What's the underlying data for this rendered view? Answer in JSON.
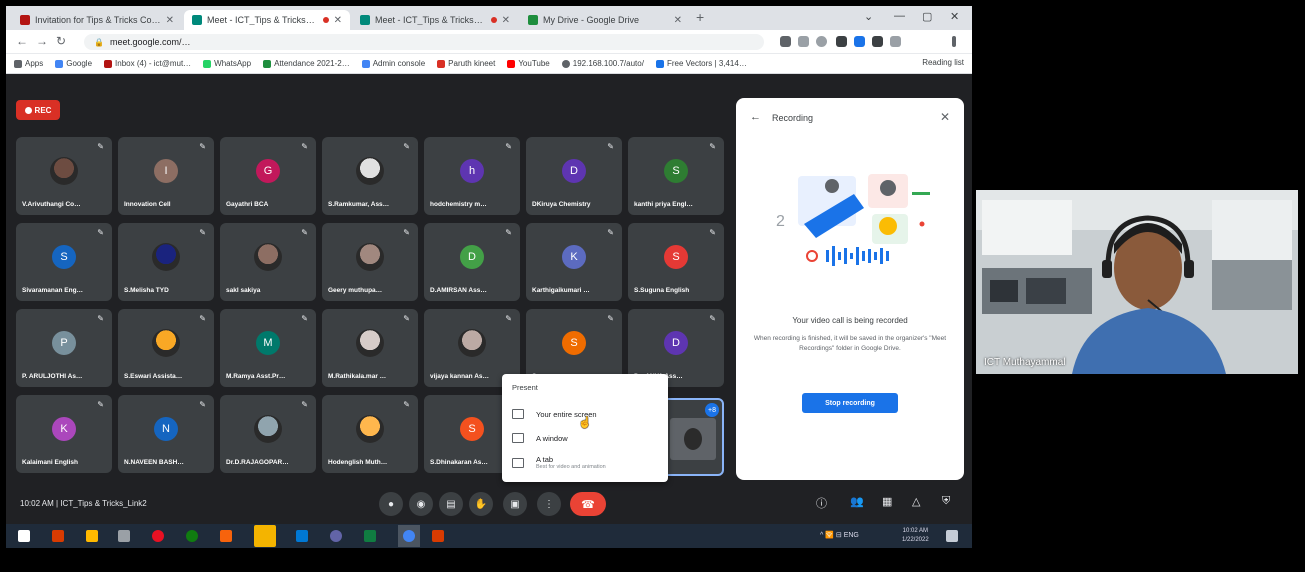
{
  "browser": {
    "tabs": [
      {
        "label": "Invitation for Tips & Tricks Co…",
        "favicon_color": "#b31412",
        "active": false,
        "recording": false
      },
      {
        "label": "Meet - ICT_Tips & Tricks_Li…",
        "favicon_color": "#00897b",
        "active": true,
        "recording": true
      },
      {
        "label": "Meet - ICT_Tips & Tricks_Li…",
        "favicon_color": "#00897b",
        "active": false,
        "recording": true
      },
      {
        "label": "My Drive - Google Drive",
        "favicon_color": "#1e8e3e",
        "active": false,
        "recording": false
      }
    ],
    "new_tab": "+",
    "url": "meet.google.com/…",
    "bookmarks": [
      {
        "label": "Apps",
        "color": "#5f6368"
      },
      {
        "label": "Google",
        "color": "#4285f4"
      },
      {
        "label": "Inbox (4) - ict@mut…",
        "color": "#b31412"
      },
      {
        "label": "WhatsApp",
        "color": "#25d366"
      },
      {
        "label": "Attendance 2021-2…",
        "color": "#1e8e3e"
      },
      {
        "label": "Admin console",
        "color": "#4285f4"
      },
      {
        "label": "Paruth kineet",
        "color": "#d93025"
      },
      {
        "label": "YouTube",
        "color": "#ff0000"
      },
      {
        "label": "192.168.100.7/auto/",
        "color": "#5f6368"
      },
      {
        "label": "Free Vectors | 3,414…",
        "color": "#1a73e8"
      }
    ],
    "reading_list": "Reading list"
  },
  "meet": {
    "rec_badge": "REC",
    "participants": [
      {
        "name": "V.Arivuthangi Co…",
        "initial": "",
        "color": "#6d4c41",
        "photo": true
      },
      {
        "name": "Innovation Cell",
        "initial": "I",
        "color": "#8d6e63",
        "photo": false
      },
      {
        "name": "Gayathri BCA",
        "initial": "G",
        "color": "#c2185b",
        "photo": false
      },
      {
        "name": "S.Ramkumar, Ass…",
        "initial": "",
        "color": "#e0e0e0",
        "photo": true
      },
      {
        "name": "hodchemistry m…",
        "initial": "h",
        "color": "#5e35b1",
        "photo": false
      },
      {
        "name": "DKiruya Chemistry",
        "initial": "D",
        "color": "#5e35b1",
        "photo": false
      },
      {
        "name": "kanthi priya Engl…",
        "initial": "S",
        "color": "#2e7d32",
        "photo": false
      },
      {
        "name": "Sivaramanan Eng…",
        "initial": "S",
        "color": "#1565c0",
        "photo": false
      },
      {
        "name": "S.Melisha TYD",
        "initial": "",
        "color": "#1a237e",
        "photo": true
      },
      {
        "name": "sakl sakiya",
        "initial": "",
        "color": "#8d6e63",
        "photo": true
      },
      {
        "name": "Geery muthupa…",
        "initial": "",
        "color": "#a1887f",
        "photo": true
      },
      {
        "name": "D.AMIRSAN Ass…",
        "initial": "D",
        "color": "#43a047",
        "photo": false
      },
      {
        "name": "Karthigaikumari …",
        "initial": "K",
        "color": "#5c6bc0",
        "photo": false
      },
      {
        "name": "S.Suguna English",
        "initial": "S",
        "color": "#e53935",
        "photo": false
      },
      {
        "name": "P. ARULJOTHI As…",
        "initial": "P",
        "color": "#78909c",
        "photo": false
      },
      {
        "name": "S.Eswari Assista…",
        "initial": "",
        "color": "#f9a825",
        "photo": true
      },
      {
        "name": "M.Ramya Asst.Pr…",
        "initial": "M",
        "color": "#00796b",
        "photo": false
      },
      {
        "name": "M.Rathikala.mar …",
        "initial": "",
        "color": "#d7ccc8",
        "photo": true
      },
      {
        "name": "vijaya kannan As…",
        "initial": "",
        "color": "#bcaaa4",
        "photo": true
      },
      {
        "name": "S…",
        "initial": "S",
        "color": "#ef6c00",
        "photo": false
      },
      {
        "name": "D…ANYA Ass…",
        "initial": "D",
        "color": "#5e35b1",
        "photo": false
      },
      {
        "name": "Kalaimani English",
        "initial": "K",
        "color": "#ab47bc",
        "photo": false
      },
      {
        "name": "N.NAVEEN BASH…",
        "initial": "N",
        "color": "#1565c0",
        "photo": false
      },
      {
        "name": "Dr.D.RAJAGOPAR…",
        "initial": "",
        "color": "#90a4ae",
        "photo": true
      },
      {
        "name": "Hodenglish Muth…",
        "initial": "",
        "color": "#ffb74d",
        "photo": true
      },
      {
        "name": "S.Dhinakaran As…",
        "initial": "S",
        "color": "#f4511e",
        "photo": false
      }
    ],
    "present_more_badge": "+8",
    "present_menu": {
      "title": "Present",
      "options": [
        {
          "label": "Your entire screen",
          "sub": ""
        },
        {
          "label": "A window",
          "sub": ""
        },
        {
          "label": "A tab",
          "sub": "Best for video and animation"
        }
      ]
    },
    "recording_panel": {
      "back": "←",
      "title": "Recording",
      "close": "✕",
      "main_text": "Your video call is being recorded",
      "sub_text": "When recording is finished, it will be saved in the organizer's \"Meet Recordings\" folder in Google Drive.",
      "stop_button": "Stop recording"
    },
    "meeting_time": "10:02 AM  |  ICT_Tips & Tricks_Link2",
    "controls": [
      {
        "name": "mic",
        "icon": "●"
      },
      {
        "name": "camera",
        "icon": "◉"
      },
      {
        "name": "captions",
        "icon": "▤"
      },
      {
        "name": "raise-hand",
        "icon": "✋"
      },
      {
        "name": "present",
        "icon": "▣"
      },
      {
        "name": "more-options",
        "icon": "⋮"
      }
    ],
    "hangup_icon": "☎",
    "right_icons": [
      {
        "name": "info",
        "icon": "ⓘ"
      },
      {
        "name": "people",
        "icon": "👥"
      },
      {
        "name": "chat",
        "icon": "▦"
      },
      {
        "name": "activities",
        "icon": "△"
      },
      {
        "name": "host-controls",
        "icon": "⛨"
      }
    ]
  },
  "taskbar": {
    "tray": "^ 🛜 ⊟ ENG",
    "time": "10:02 AM",
    "date": "1/22/2022"
  },
  "speaker": {
    "name": "ICT Muthayammal"
  },
  "colors": {
    "meet_bg": "#202124",
    "tile_bg": "#3c4043",
    "accent_blue": "#1a73e8",
    "hangup_red": "#ea4335",
    "rec_red": "#d93025"
  }
}
